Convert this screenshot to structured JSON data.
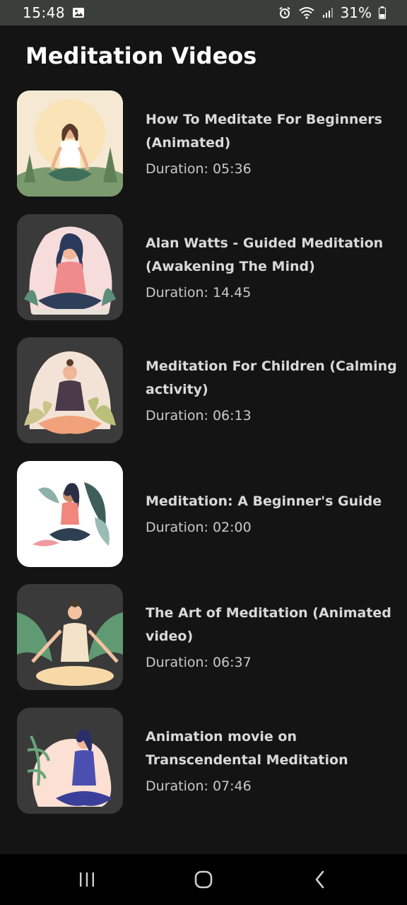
{
  "status_bar": {
    "time": "15:48",
    "battery": "31%",
    "icons": [
      "gallery-icon",
      "alarm-icon",
      "wifi-icon",
      "signal-icon",
      "battery-icon"
    ]
  },
  "page": {
    "title": "Meditation Videos"
  },
  "videos": [
    {
      "title": "How To Meditate For Beginners (Animated)",
      "duration": "Duration: 05:36",
      "thumb_bg": "#f5e9d3"
    },
    {
      "title": "Alan Watts - Guided Meditation (Awakening The Mind)",
      "duration": "Duration: 14.45",
      "thumb_bg": "#f7dcdc"
    },
    {
      "title": "Meditation For Children (Calming activity)",
      "duration": "Duration: 06:13",
      "thumb_bg": "#f3e3d6"
    },
    {
      "title": "Meditation: A Beginner's Guide",
      "duration": "Duration: 02:00",
      "thumb_bg": "#ffffff"
    },
    {
      "title": "The Art of Meditation (Animated video)",
      "duration": "Duration: 06:37",
      "thumb_bg": "#3a3a3a"
    },
    {
      "title": "Animation movie on Transcendental Meditation",
      "duration": "Duration: 07:46",
      "thumb_bg": "#fbe0d3"
    }
  ],
  "nav_bar": {
    "icons": [
      "recent-apps-icon",
      "home-icon",
      "back-icon"
    ]
  },
  "colors": {
    "background": "#141414",
    "status_bar": "#3b3f3c",
    "title_text": "#ffffff",
    "item_text": "#d9d9d9"
  }
}
